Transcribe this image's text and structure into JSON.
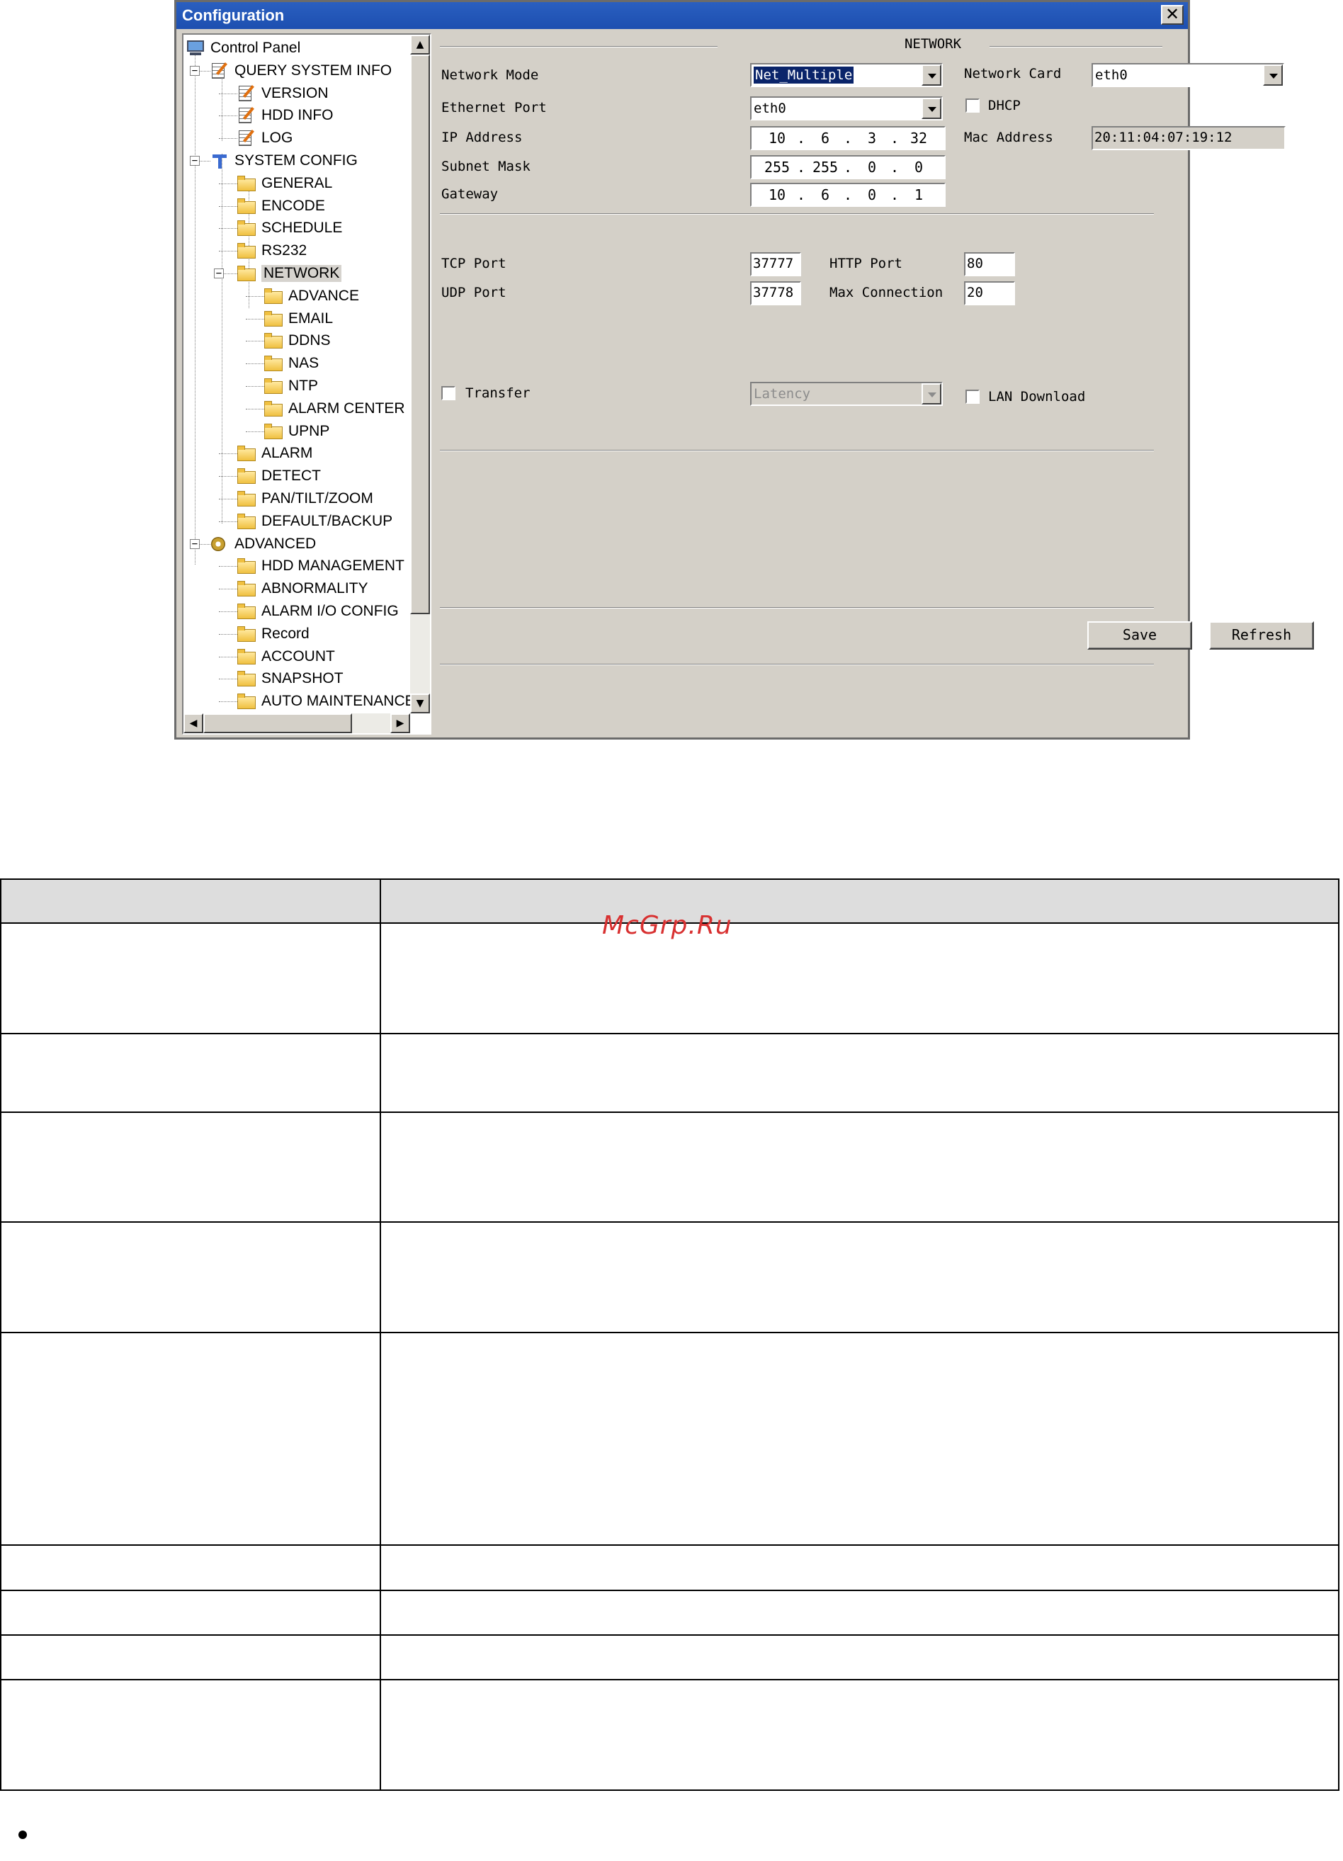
{
  "window": {
    "title": "Configuration",
    "close_label": "✕"
  },
  "tree": {
    "items": [
      {
        "label": "Control Panel",
        "icon": "computer-icon"
      },
      {
        "label": "QUERY SYSTEM INFO",
        "icon": "document-edit-icon"
      },
      {
        "label": "VERSION",
        "icon": "document-edit-icon"
      },
      {
        "label": "HDD INFO",
        "icon": "document-edit-icon"
      },
      {
        "label": "LOG",
        "icon": "document-edit-icon"
      },
      {
        "label": "SYSTEM CONFIG",
        "icon": "tools-icon"
      },
      {
        "label": "GENERAL",
        "icon": "folder-icon"
      },
      {
        "label": "ENCODE",
        "icon": "folder-icon"
      },
      {
        "label": "SCHEDULE",
        "icon": "folder-icon"
      },
      {
        "label": "RS232",
        "icon": "folder-icon"
      },
      {
        "label": "NETWORK",
        "icon": "folder-open-icon"
      },
      {
        "label": "ADVANCE",
        "icon": "folder-icon"
      },
      {
        "label": "EMAIL",
        "icon": "folder-icon"
      },
      {
        "label": "DDNS",
        "icon": "folder-icon"
      },
      {
        "label": "NAS",
        "icon": "folder-icon"
      },
      {
        "label": "NTP",
        "icon": "folder-icon"
      },
      {
        "label": "ALARM CENTER",
        "icon": "folder-icon"
      },
      {
        "label": "UPNP",
        "icon": "folder-icon"
      },
      {
        "label": "ALARM",
        "icon": "folder-icon"
      },
      {
        "label": "DETECT",
        "icon": "folder-icon"
      },
      {
        "label": "PAN/TILT/ZOOM",
        "icon": "folder-icon"
      },
      {
        "label": "DEFAULT/BACKUP",
        "icon": "folder-icon"
      },
      {
        "label": "ADVANCED",
        "icon": "gears-icon"
      },
      {
        "label": "HDD MANAGEMENT",
        "icon": "folder-icon"
      },
      {
        "label": "ABNORMALITY",
        "icon": "folder-icon"
      },
      {
        "label": "ALARM I/O CONFIG",
        "icon": "folder-icon"
      },
      {
        "label": "Record",
        "icon": "folder-icon"
      },
      {
        "label": "ACCOUNT",
        "icon": "folder-icon"
      },
      {
        "label": "SNAPSHOT",
        "icon": "folder-icon"
      },
      {
        "label": "AUTO MAINTENANCE",
        "icon": "folder-icon"
      }
    ],
    "selected": "NETWORK"
  },
  "network": {
    "group_title": "NETWORK",
    "network_mode": {
      "label": "Network Mode",
      "value": "Net_Multiple"
    },
    "network_card": {
      "label": "Network Card",
      "value": "eth0"
    },
    "ethernet_port": {
      "label": "Ethernet Port",
      "value": "eth0"
    },
    "dhcp": {
      "label": "DHCP",
      "checked": false
    },
    "ip_address": {
      "label": "IP Address",
      "octets": [
        "10",
        "6",
        "3",
        "32"
      ]
    },
    "mac_address": {
      "label": "Mac Address",
      "value": "20:11:04:07:19:12"
    },
    "subnet_mask": {
      "label": "Subnet Mask",
      "octets": [
        "255",
        "255",
        "0",
        "0"
      ]
    },
    "gateway": {
      "label": "Gateway",
      "octets": [
        "10",
        "6",
        "0",
        "1"
      ]
    },
    "tcp_port": {
      "label": "TCP Port",
      "value": "37777"
    },
    "http_port": {
      "label": "HTTP Port",
      "value": "80"
    },
    "udp_port": {
      "label": "UDP Port",
      "value": "37778"
    },
    "max_connection": {
      "label": "Max Connection",
      "value": "20"
    },
    "transfer": {
      "label": "Transfer",
      "checked": false,
      "mode": "Latency"
    },
    "lan_download": {
      "label": "LAN Download",
      "checked": false
    },
    "save_label": "Save",
    "refresh_label": "Refresh"
  },
  "watermark": "McGrp.Ru",
  "colors": {
    "title_bar": "#1d4fb0",
    "dialog_face": "#d4d0c8",
    "selection": "#0a246a",
    "watermark": "#d83030"
  }
}
